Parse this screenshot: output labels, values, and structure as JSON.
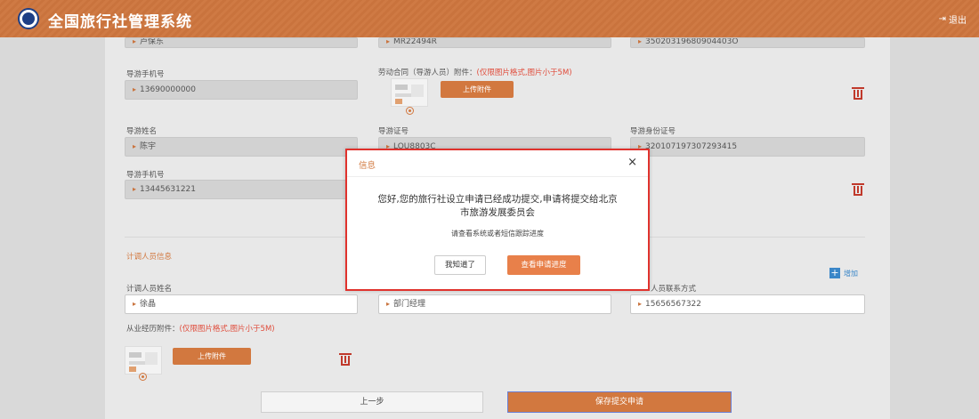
{
  "header": {
    "title": "全国旅行社管理系统",
    "logout": "退出"
  },
  "top_partial_row": {
    "v1": "卢保东",
    "v2": "MR22494R",
    "v3": "35020319680904403O"
  },
  "guide1": {
    "phone_label": "导游手机号",
    "phone": "13690000000",
    "contract_label": "劳动合同（导游人员）附件：",
    "contract_note": "(仅限图片格式,图片小于5M)",
    "upload": "上传附件"
  },
  "guide2": {
    "name_label": "导游姓名",
    "name": "陈宇",
    "cert_label": "导游证号",
    "cert": "LOU8803C",
    "id_label": "导游身份证号",
    "id": "320107197307293415",
    "phone_label": "导游手机号",
    "phone": "13445631221"
  },
  "planner": {
    "section_title": "计调人员信息",
    "add_label": "增加",
    "name_label": "计调人员姓名",
    "name": "徐晶",
    "position": "部门经理",
    "contact_label": "人员联系方式",
    "contact": "15656567322",
    "exp_label": "从业经历附件：",
    "exp_note": "(仅限图片格式,图片小于5M)",
    "upload": "上传附件"
  },
  "buttons": {
    "prev": "上一步",
    "save": "保存提交申请"
  },
  "dialog": {
    "title": "信息",
    "close": "×",
    "msg_line1": "您好,您的旅行社设立申请已经成功提交,申请将提交给北京",
    "msg_line2": "市旅游发展委员会",
    "sub": "请查看系统或者短信跟踪进度",
    "ok": "我知道了",
    "progress": "查看申请进度"
  },
  "colors": {
    "brand": "#c9733d",
    "accent": "#d2783f",
    "alert_border": "#e0322d",
    "link": "#3a86c8"
  }
}
